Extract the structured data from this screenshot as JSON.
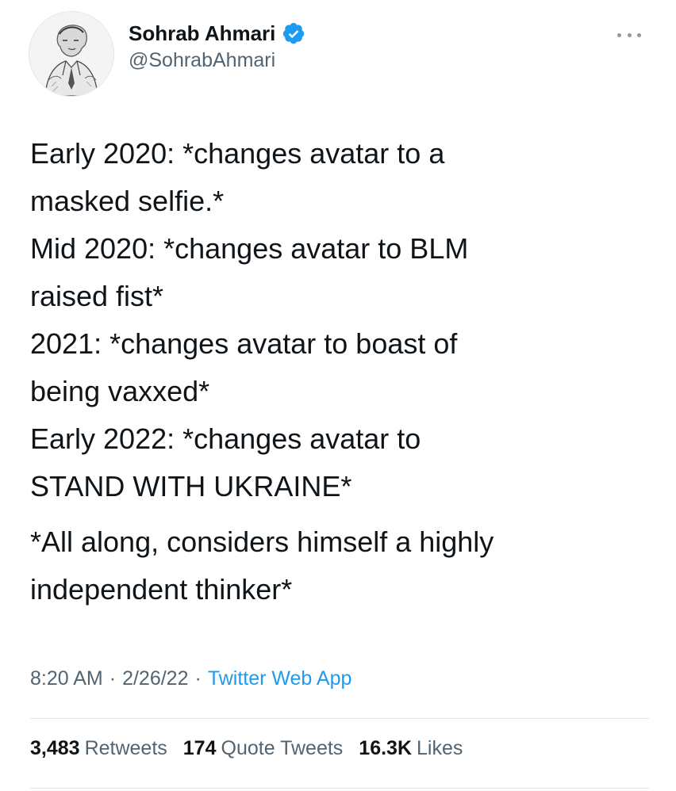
{
  "author": {
    "display_name": "Sohrab Ahmari",
    "handle": "@SohrabAhmari",
    "verified": true,
    "avatar_icon": "sketch-portrait-avatar",
    "verified_color": "#1d9bf0"
  },
  "menu_icon": "more-horizontal-icon",
  "tweet": {
    "paragraphs": [
      "Early 2020: *changes avatar to a\nmasked selfie.*\nMid 2020: *changes avatar to BLM\nraised fist*\n2021: *changes avatar to boast of\nbeing vaxxed*\nEarly 2022: *changes avatar to\nSTAND WITH UKRAINE*",
      "*All along, considers himself a highly\nindependent thinker*"
    ]
  },
  "meta": {
    "time": "8:20 AM",
    "separator": "·",
    "date": "2/26/22",
    "source": "Twitter Web App"
  },
  "stats": {
    "retweets": {
      "count": "3,483",
      "label": "Retweets"
    },
    "quote_tweets": {
      "count": "174",
      "label": "Quote Tweets"
    },
    "likes": {
      "count": "16.3K",
      "label": "Likes"
    }
  },
  "colors": {
    "text": "#0f1419",
    "secondary": "#536471",
    "link": "#1d9bf0",
    "divider": "#e1e6ea"
  }
}
